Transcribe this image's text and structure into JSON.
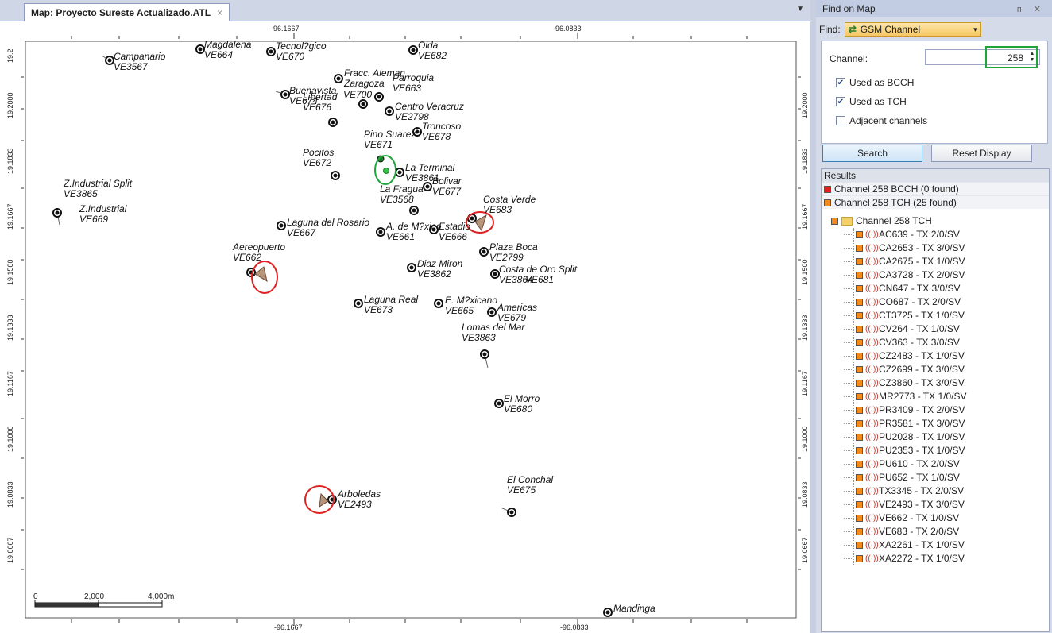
{
  "document_tab": {
    "title": "Map: Proyecto Sureste Actualizado.ATL",
    "close_symbol": "×",
    "dropdown_symbol": "▼"
  },
  "map": {
    "top_ticks": [
      "-96.1667",
      "-96.0833"
    ],
    "bottom_ticks": [
      "-96.1667",
      "-96.0833"
    ],
    "left_ticks": [
      "19.2",
      "19.2000",
      "19.1833",
      "19.1667",
      "19.1500",
      "19.1333",
      "19.1167",
      "19.1000",
      "19.0833",
      "19.0667"
    ],
    "right_ticks": [
      "19.2000",
      "19.1833",
      "19.1667",
      "19.1500",
      "19.1333",
      "19.1167",
      "19.1000",
      "19.0833",
      "19.0667"
    ],
    "scale_bar": [
      "0",
      "2,000",
      "4,000m"
    ],
    "sites": [
      {
        "label": "Campanario\nVE3567"
      },
      {
        "label": "Magdalena\nVE664"
      },
      {
        "label": "Tecnol?gico\nVE670"
      },
      {
        "label": "Olda\nVE682"
      },
      {
        "label": "Fracc. Aleman\nZaragoza"
      },
      {
        "label": "Parroquia\nVE663"
      },
      {
        "label": "Buenavista\nVE674"
      },
      {
        "label": "Libertad\nVE676"
      },
      {
        "label": "VE700"
      },
      {
        "label": "Centro Veracruz\nVE2798"
      },
      {
        "label": "Troncoso\nVE678"
      },
      {
        "label": "Pino Suarez\nVE671"
      },
      {
        "label": "Pocitos\nVE672"
      },
      {
        "label": "La Terminal\nVE3861"
      },
      {
        "label": "Bolivar\nVE677"
      },
      {
        "label": "La Fragua\nVE3568"
      },
      {
        "label": "Costa Verde\nVE683"
      },
      {
        "label": "Z.Industrial Split\nVE3865"
      },
      {
        "label": "Z.Industrial\nVE669"
      },
      {
        "label": "Laguna del Rosario\nVE667"
      },
      {
        "label": "A. de M?xico\nVE661"
      },
      {
        "label": "Estadio\nVE666"
      },
      {
        "label": "Aereopuerto\nVE662"
      },
      {
        "label": "Plaza Boca\nVE2799"
      },
      {
        "label": "Diaz Miron\nVE3862"
      },
      {
        "label": "Costa de Oro Split\nVE3864"
      },
      {
        "label": "VE681"
      },
      {
        "label": "Laguna Real\nVE673"
      },
      {
        "label": "E. M?xicano\nVE665"
      },
      {
        "label": "Americas\nVE679"
      },
      {
        "label": "Lomas del Mar\nVE3863"
      },
      {
        "label": "El Morro\nVE680"
      },
      {
        "label": "El Conchal\nVE675"
      },
      {
        "label": "Arboledas\nVE2493"
      },
      {
        "label": "Mandinga"
      }
    ]
  },
  "panel": {
    "title": "Find on Map",
    "header_icons": "ᴨ ✕",
    "find_label": "Find:",
    "find_value": "GSM Channel",
    "channel_label": "Channel:",
    "channel_value": "258",
    "cb_bcch": "Used as BCCH",
    "cb_tch": "Used as TCH",
    "cb_adjacent": "Adjacent channels",
    "search_button": "Search",
    "reset_button": "Reset Display",
    "results_title": "Results",
    "summary_bcch": "Channel 258 BCCH (0 found)",
    "summary_tch": "Channel 258 TCH (25 found)",
    "tree_root": "Channel 258 TCH",
    "items": [
      "AC639 - TX 2/0/SV",
      "CA2653 - TX 3/0/SV",
      "CA2675 - TX 1/0/SV",
      "CA3728 - TX 2/0/SV",
      "CN647 - TX 3/0/SV",
      "CO687 - TX 2/0/SV",
      "CT3725 - TX 1/0/SV",
      "CV264 - TX 1/0/SV",
      "CV363 - TX 3/0/SV",
      "CZ2483 - TX 1/0/SV",
      "CZ2699 - TX 3/0/SV",
      "CZ3860 - TX 3/0/SV",
      "MR2773 - TX 1/0/SV",
      "PR3409 - TX 2/0/SV",
      "PR3581 - TX 3/0/SV",
      "PU2028 - TX 1/0/SV",
      "PU2353 - TX 1/0/SV",
      "PU610 - TX 2/0/SV",
      "PU652 - TX 1/0/SV",
      "TX3345 - TX 2/0/SV",
      "VE2493 - TX 3/0/SV",
      "VE662 - TX 1/0/SV",
      "VE683 - TX 2/0/SV",
      "XA2261 - TX 1/0/SV",
      "XA2272 - TX 1/0/SV"
    ],
    "colors": {
      "bcch": "#e32020",
      "tch": "#f28a1e",
      "highlight_green": "#1fa53a",
      "highlight_red": "#e02020"
    }
  }
}
